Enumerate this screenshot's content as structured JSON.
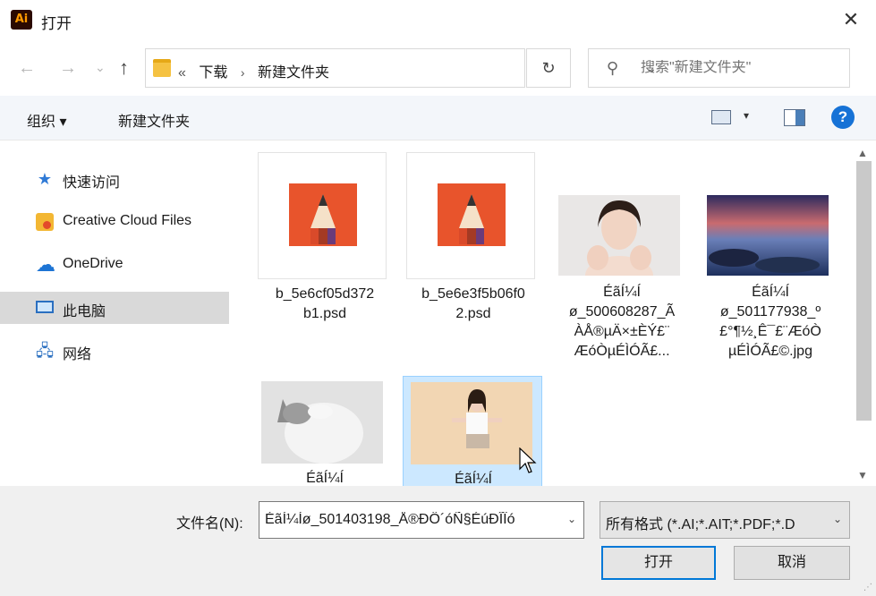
{
  "window": {
    "app_icon_text": "Ai",
    "title": "打开",
    "close_glyph": "✕"
  },
  "nav": {
    "back_glyph": "←",
    "forward_glyph": "→",
    "recent_glyph": "⌄",
    "up_glyph": "↑",
    "crumb_prefix": "«",
    "crumbs": [
      "下载",
      "新建文件夹"
    ],
    "crumb_sep": "›",
    "dropdown_glyph": "⌄",
    "refresh_glyph": "↻",
    "search_placeholder": "搜索\"新建文件夹\""
  },
  "toolbar": {
    "organize_label": "组织 ▾",
    "new_folder_label": "新建文件夹",
    "view_arrow": "▾",
    "help_label": "?"
  },
  "sidebar": {
    "items": [
      {
        "label": "快速访问",
        "icon": "star-icon"
      },
      {
        "label": "Creative Cloud Files",
        "icon": "creative-cloud-icon"
      },
      {
        "label": "OneDrive",
        "icon": "cloud-icon"
      },
      {
        "label": "此电脑",
        "icon": "computer-icon",
        "selected": true
      },
      {
        "label": "网络",
        "icon": "network-icon"
      }
    ]
  },
  "files": [
    {
      "name": "b_5e6cf05d372\nb1.psd",
      "kind": "psd"
    },
    {
      "name": "b_5e6e3f5b06f0\n2.psd",
      "kind": "psd"
    },
    {
      "name": "ÉãÍ¼Í\nø_500608287_Ã\nÀÅ®µÄ×±ÈÝ£¨\nÆóÒµÉÌÓÃ£...",
      "kind": "photo-woman"
    },
    {
      "name": "ÉãÍ¼Í\nø_501177938_º\n£°¶½¸Ê¯£¨ÆóÒ\nµÉÌÓÃ£©.jpg",
      "kind": "photo-sea"
    },
    {
      "name": "ÉãÍ¼Í",
      "kind": "photo-cat"
    },
    {
      "name": "ÉãÍ¼Í",
      "kind": "photo-girl",
      "selected": true
    }
  ],
  "bottom": {
    "filename_label": "文件名(N):",
    "filename_value": "ÉãÍ¼Íø_501403198_Å®ÐÔ´óÑ§ÉúÐÎÏó",
    "filetype_value": "所有格式 (*.AI;*.AIT;*.PDF;*.D",
    "dd_glyph": "⌄",
    "open_label": "打开",
    "cancel_label": "取消"
  },
  "colors": {
    "accent": "#0078d7",
    "selection_bg": "#cce8ff",
    "psd_orange": "#e8542c"
  }
}
